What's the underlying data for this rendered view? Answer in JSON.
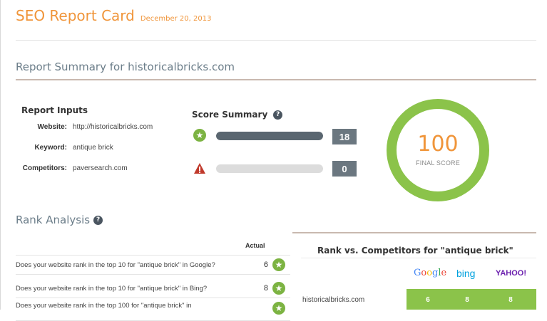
{
  "header": {
    "title": "SEO Report Card",
    "date": "December 20, 2013"
  },
  "summary": {
    "title": "Report Summary for historicalbricks.com"
  },
  "inputs": {
    "title": "Report Inputs",
    "rows": [
      {
        "key": "Website:",
        "value": "http://historicalbricks.com"
      },
      {
        "key": "Keyword:",
        "value": "antique brick"
      },
      {
        "key": "Competitors:",
        "value": "paversearch.com"
      }
    ]
  },
  "score_summary": {
    "title": "Score Summary",
    "help": "?",
    "passed": {
      "icon": "star-icon",
      "count": "18",
      "fill": 1.0
    },
    "failed": {
      "icon": "warning-icon",
      "count": "0",
      "fill": 0.0
    }
  },
  "final_score": {
    "value": "100",
    "label": "FINAL SCORE",
    "fill": 1.0
  },
  "rank_analysis": {
    "title": "Rank Analysis",
    "help": "?",
    "actual_header": "Actual",
    "rows": [
      {
        "question": "Does your website rank in the top 10 for \"antique brick\" in Google?",
        "actual": "6"
      },
      {
        "question": "Does your website rank in the top 10 for \"antique brick\" in Bing?",
        "actual": "8"
      },
      {
        "question": "Does your website rank in the top 100 for \"antique brick\" in",
        "actual": ""
      }
    ]
  },
  "competitors": {
    "title": "Rank vs. Competitors for \"antique brick\"",
    "engines": [
      "Google",
      "bing",
      "YAHOO!"
    ],
    "rows": [
      {
        "site": "historicalbricks.com",
        "google": "6",
        "bing": "8",
        "yahoo": "8"
      }
    ]
  },
  "colors": {
    "accent": "#f0953a",
    "good": "#8bc34a",
    "bad": "#c0392b",
    "bar": "#5a6670"
  }
}
